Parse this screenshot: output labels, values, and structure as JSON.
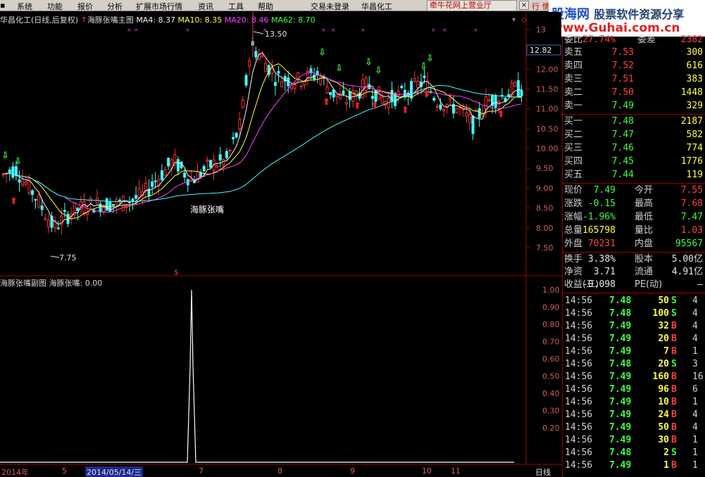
{
  "menu": {
    "items": [
      "系统",
      "功能",
      "报价",
      "分析",
      "扩展市场行情",
      "资讯",
      "工具",
      "帮助"
    ],
    "login": "交易未登录",
    "stock_name": "华昌化工",
    "broker": "牵牛花网上营业厅",
    "right_tabs": [
      "行",
      "情"
    ]
  },
  "logo": {
    "brand": "股海网",
    "slogan": "股票软件资源分享",
    "url": "www.Guhai.com.cn"
  },
  "main_chart": {
    "title": "华昌化工(日线,后复权)",
    "indicator": "海豚张嘴主图",
    "ma4": "MA4: 8.37",
    "ma10": "MA10: 8.35",
    "ma20": "MA20: 8.46",
    "ma62": "MA62: 8.70",
    "high_label": "13.50",
    "low_label": "7.75",
    "signal_label": "海豚张嘴",
    "current_price_tag": "12.82",
    "y_ticks": [
      "13",
      "12.50",
      "12.00",
      "11.50",
      "11.00",
      "10.50",
      "10.00",
      "9.50",
      "9.00",
      "8.50",
      "8.00",
      "7.50"
    ],
    "colors": {
      "up": "#ff3030",
      "down": "#40ffff",
      "ma4": "#f0f0f0",
      "ma10": "#ffff40",
      "ma20": "#ff40ff",
      "ma62": "#40ffff",
      "grid": "#8b0000"
    }
  },
  "sub_chart": {
    "title": "海豚张嘴副图",
    "value": "海豚张嘴: 0.00",
    "y_ticks": [
      "1.00",
      "0.90",
      "0.80",
      "0.70",
      "0.60",
      "0.50",
      "0.40",
      "0.30",
      "0.20"
    ]
  },
  "date_axis": {
    "labels": [
      "2014年",
      "5",
      "2014/05/14/三",
      "7",
      "8",
      "9",
      "10",
      "11"
    ],
    "period": "日线"
  },
  "quote": {
    "weibi_label": "委比",
    "weibi_value": "27.74%",
    "weicha_label": "委差",
    "weicha_value": "2382",
    "asks": [
      {
        "label": "卖五",
        "price": "7.53",
        "vol": "300"
      },
      {
        "label": "卖四",
        "price": "7.52",
        "vol": "616"
      },
      {
        "label": "卖三",
        "price": "7.51",
        "vol": "383"
      },
      {
        "label": "卖二",
        "price": "7.50",
        "vol": "1448"
      },
      {
        "label": "卖一",
        "price": "7.49",
        "vol": "329"
      }
    ],
    "bids": [
      {
        "label": "买一",
        "price": "7.48",
        "vol": "2187"
      },
      {
        "label": "买二",
        "price": "7.47",
        "vol": "582"
      },
      {
        "label": "买三",
        "price": "7.46",
        "vol": "774"
      },
      {
        "label": "买四",
        "price": "7.45",
        "vol": "1776"
      },
      {
        "label": "买五",
        "price": "7.44",
        "vol": "119"
      }
    ],
    "stats": [
      {
        "l1": "现价",
        "v1": "7.49",
        "c1": "green",
        "l2": "今开",
        "v2": "7.55",
        "c2": "red"
      },
      {
        "l1": "涨跌",
        "v1": "-0.15",
        "c1": "green",
        "l2": "最高",
        "v2": "7.68",
        "c2": "red"
      },
      {
        "l1": "涨幅",
        "v1": "-1.96%",
        "c1": "green",
        "l2": "最低",
        "v2": "7.47",
        "c2": "green"
      },
      {
        "l1": "总量",
        "v1": "165798",
        "c1": "yellow",
        "l2": "量比",
        "v2": "1.03",
        "c2": "red"
      },
      {
        "l1": "外盘",
        "v1": "70231",
        "c1": "red",
        "l2": "内盘",
        "v2": "95567",
        "c2": "green"
      }
    ],
    "fundamentals": [
      {
        "l1": "换手",
        "v1": "3.38%",
        "l2": "股本",
        "v2": "5.00亿"
      },
      {
        "l1": "净资",
        "v1": "3.71",
        "l2": "流通",
        "v2": "4.91亿"
      },
      {
        "l1": "收益(三)",
        "v1": "-0.098",
        "l2": "PE(动)",
        "v2": "—"
      }
    ]
  },
  "ticks": [
    {
      "time": "14:56",
      "price": "7.48",
      "vol": "50",
      "bs": "S",
      "cnt": "4"
    },
    {
      "time": "14:56",
      "price": "7.48",
      "vol": "100",
      "bs": "S",
      "cnt": "4"
    },
    {
      "time": "14:56",
      "price": "7.49",
      "vol": "32",
      "bs": "B",
      "cnt": "4"
    },
    {
      "time": "14:56",
      "price": "7.49",
      "vol": "20",
      "bs": "B",
      "cnt": "4"
    },
    {
      "time": "14:56",
      "price": "7.49",
      "vol": "7",
      "bs": "B",
      "cnt": "1"
    },
    {
      "time": "14:56",
      "price": "7.48",
      "vol": "20",
      "bs": "S",
      "cnt": "3"
    },
    {
      "time": "14:56",
      "price": "7.49",
      "vol": "160",
      "bs": "B",
      "cnt": "16"
    },
    {
      "time": "14:56",
      "price": "7.49",
      "vol": "96",
      "bs": "B",
      "cnt": "6"
    },
    {
      "time": "14:56",
      "price": "7.49",
      "vol": "10",
      "bs": "B",
      "cnt": "1"
    },
    {
      "time": "14:56",
      "price": "7.49",
      "vol": "24",
      "bs": "B",
      "cnt": "4"
    },
    {
      "time": "14:56",
      "price": "7.49",
      "vol": "50",
      "bs": "B",
      "cnt": "4"
    },
    {
      "time": "14:56",
      "price": "7.49",
      "vol": "30",
      "bs": "B",
      "cnt": "1"
    },
    {
      "time": "14:56",
      "price": "7.48",
      "vol": "2",
      "bs": "S",
      "cnt": "1"
    },
    {
      "time": "14:56",
      "price": "7.49",
      "vol": "1",
      "bs": "B",
      "cnt": "1"
    }
  ]
}
